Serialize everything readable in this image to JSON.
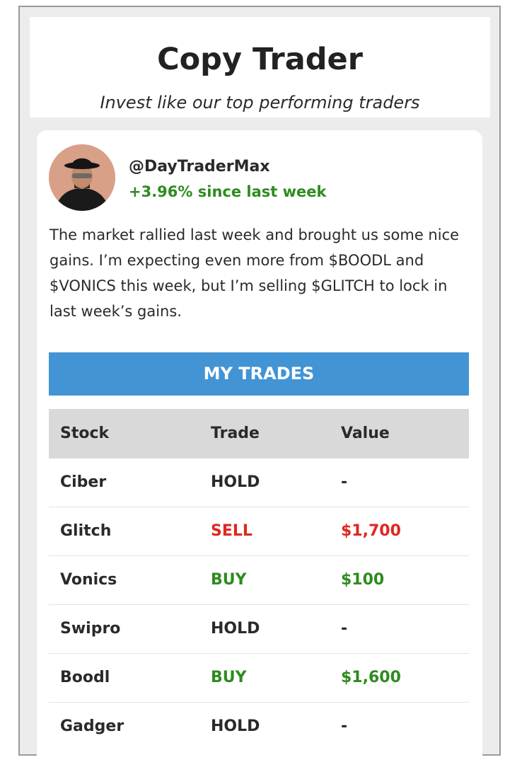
{
  "header": {
    "title": "Copy Trader",
    "subtitle": "Invest like our top performing traders"
  },
  "trader": {
    "avatar_icon": "person-with-hat-avatar",
    "username": "@DayTraderMax",
    "performance": "+3.96% since last week",
    "post": "The market rallied last week and brought us some nice gains. I’m expecting even more from $BOODL and $VONICS this week, but I’m selling $GLITCH to lock in last week’s gains."
  },
  "trades": {
    "banner": "MY TRADES",
    "columns": [
      "Stock",
      "Trade",
      "Value"
    ],
    "rows": [
      {
        "stock": "Ciber",
        "trade": "HOLD",
        "value": "-"
      },
      {
        "stock": "Glitch",
        "trade": "SELL",
        "value": "$1,700"
      },
      {
        "stock": "Vonics",
        "trade": "BUY",
        "value": "$100"
      },
      {
        "stock": "Swipro",
        "trade": "HOLD",
        "value": "-"
      },
      {
        "stock": "Boodl",
        "trade": "BUY",
        "value": "$1,600"
      },
      {
        "stock": "Gadger",
        "trade": "HOLD",
        "value": "-"
      }
    ]
  },
  "colors": {
    "accent_banner": "#4294d4",
    "buy": "#2e8b1f",
    "sell": "#e0261f",
    "hold": "#2a2a2a",
    "performance_positive": "#2e8b1f"
  }
}
